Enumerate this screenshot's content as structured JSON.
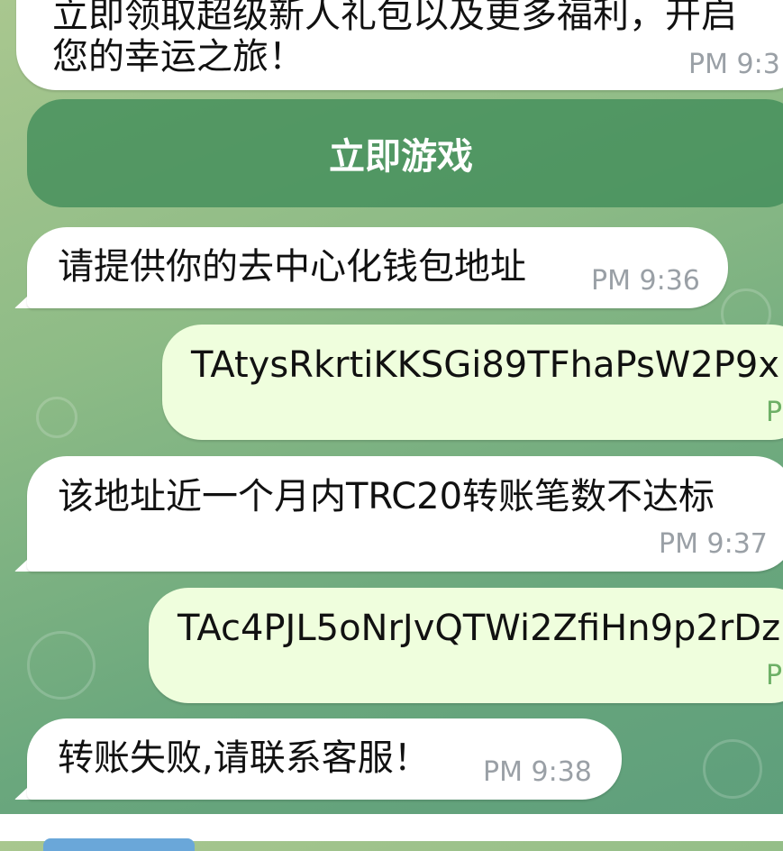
{
  "messages": [
    {
      "id": "promo",
      "direction": "incoming",
      "line1": "立即领取超级新人礼包以及更多福利，开启",
      "line2": "您的幸运之旅！",
      "time": "PM 9:3"
    },
    {
      "id": "ask-wallet",
      "direction": "incoming",
      "text": "请提供你的去中心化钱包地址",
      "time": "PM 9:36"
    },
    {
      "id": "addr-1",
      "direction": "outgoing",
      "text": "TAtysRkrtiKKSGi89TFhaPsW2P9x",
      "time": "P"
    },
    {
      "id": "not-eligible",
      "direction": "incoming",
      "text": "该地址近一个月内TRC20转账笔数不达标",
      "time": "PM 9:37"
    },
    {
      "id": "addr-2",
      "direction": "outgoing",
      "text": "TAc4PJL5oNrJvQTWi2ZfiHn9p2rDz",
      "time": "P"
    },
    {
      "id": "transfer-failed",
      "direction": "incoming",
      "text": "转账失败,请联系客服！",
      "time": "PM 9:38"
    }
  ],
  "inline_button": {
    "label": "立即游戏"
  },
  "colors": {
    "incoming_bubble": "#ffffff",
    "outgoing_bubble": "#effedd",
    "button": "#3f8c58",
    "time_incoming": "#9aa0a6",
    "time_outgoing": "#6db066",
    "composer_accent": "#6aa7d9"
  }
}
